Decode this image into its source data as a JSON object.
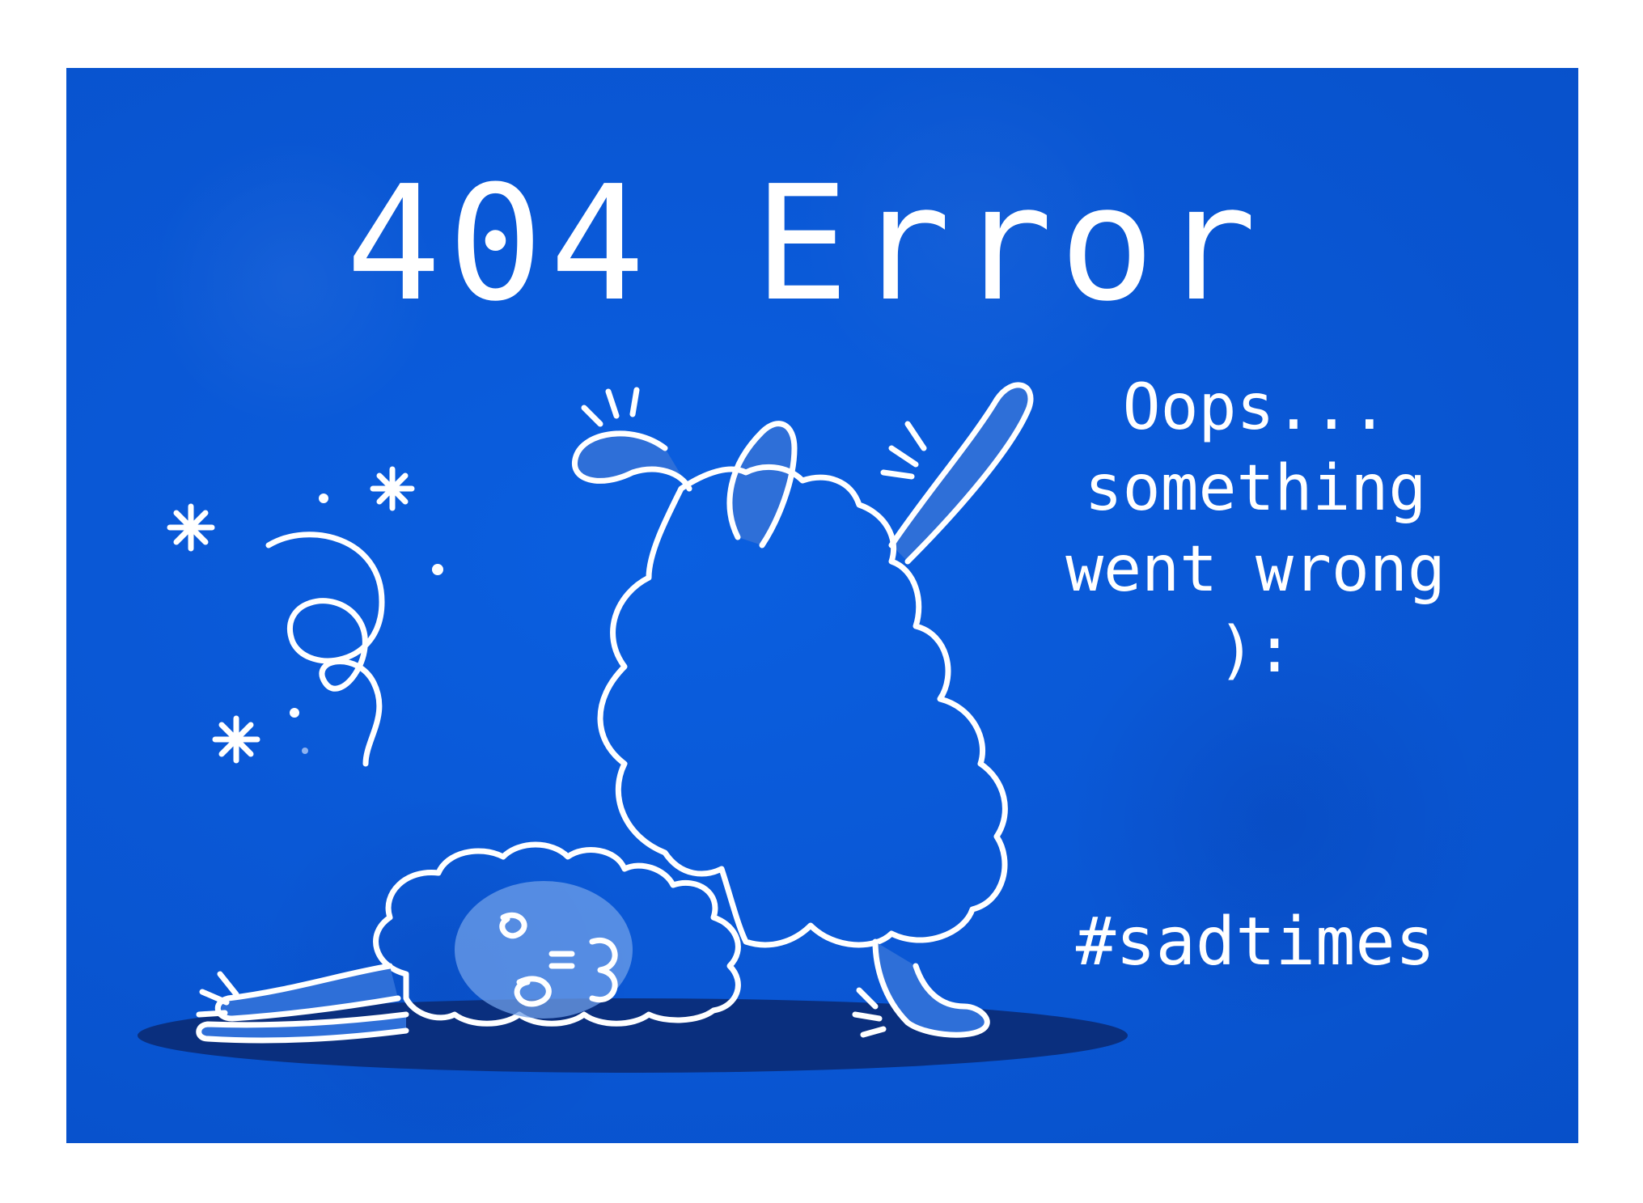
{
  "page": {
    "title": "404 Error",
    "message_lines": [
      "Oops...",
      "something",
      "went wrong",
      "):"
    ],
    "hashtag": "#sadtimes"
  },
  "colors": {
    "background": "#0a58d6",
    "ink": "#ffffff",
    "shadow": "#0a2f7e",
    "fill": "#2e6fd8"
  },
  "illustration": {
    "subject": "dizzy-sheep-icon"
  }
}
